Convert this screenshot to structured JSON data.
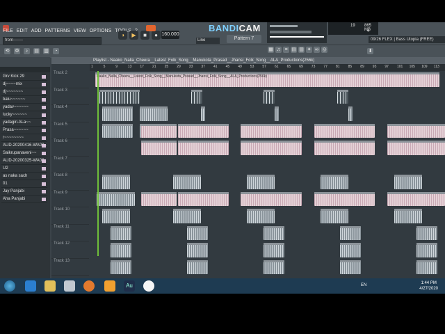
{
  "menu": [
    "FILE",
    "EDIT",
    "ADD",
    "PATTERNS",
    "VIEW",
    "OPTIONS",
    "TOOLS",
    "?"
  ],
  "project_field": "from-------",
  "tempo": "160.000",
  "recorder_watermark": {
    "prefix": "BANDI",
    "suffix": "CAM"
  },
  "pattern": "Pattern 7",
  "snap": "Line",
  "memory": {
    "cpu": "19",
    "mem": "865 MB",
    "voices": "4"
  },
  "plugin_bar": "09/26  FLEX | Bass Utopia (FREE)",
  "playlist_title": "Playlist - Naako_Nalla_Cheera__Latest_Folk_Song__Manukota_Prasad__Jhansi_Folk_Song__ALA_Productions(256k)",
  "ruler_marks": [
    "1",
    "5",
    "9",
    "13",
    "17",
    "21",
    "25",
    "29",
    "33",
    "37",
    "41",
    "45",
    "49",
    "53",
    "57",
    "61",
    "65",
    "69",
    "73",
    "77",
    "81",
    "85",
    "89",
    "93",
    "97",
    "101",
    "105",
    "109",
    "113"
  ],
  "channels": [
    "Grv Kick 29",
    "dj~~~~mix",
    "dj~~~~~~~",
    "balu~~~~~~",
    "yadav~~~~~~",
    "lucky~~~~~~",
    "yadagiri.ALa~~",
    "Prasa~~~~~~",
    "r~~~~~~~~",
    "AUD-20200416-WA00..",
    "Saikrupanaveni~~",
    "AUD-20200325-WA00..",
    "U2",
    "as naka sach",
    "01",
    "Jay Panjabi",
    "Aha Panjabi"
  ],
  "tracks": [
    "Track 2",
    "Track 3",
    "Track 4",
    "Track 5",
    "Track 6",
    "Track 7",
    "Track 8",
    "Track 9",
    "Track 10",
    "Track 11",
    "Track 12",
    "Track 13"
  ],
  "clip_banner": "Naako_Nalla_Cheera__Latest_Folk_Song__Manukota_Prasad__Jhansi_Folk_Song__ALA_Productions(256k)",
  "taskbar": {
    "lang": "EN",
    "time": "1:44 PM",
    "date": "4/27/2020"
  },
  "colors": {
    "accent": "#f0c060",
    "playhead": "#6fbf3a",
    "taskbar": "#1e3b52"
  }
}
